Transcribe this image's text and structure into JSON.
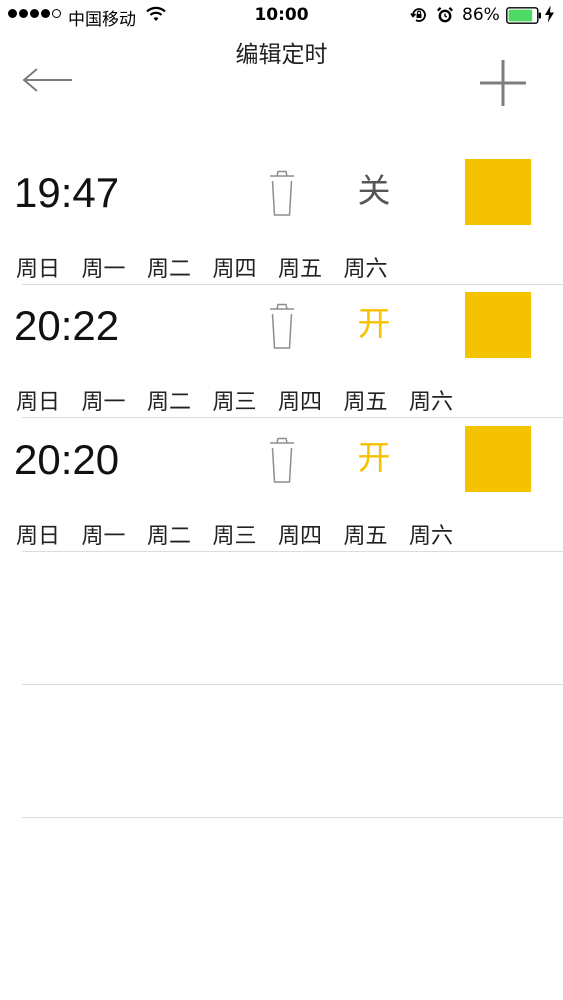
{
  "status_bar": {
    "signal_bars": [
      true,
      true,
      true,
      true,
      false
    ],
    "carrier": "中国移动",
    "wifi_icon": "wifi-icon",
    "time": "10:00",
    "rotation_lock_icon": "rotation-lock-icon",
    "alarm_icon": "alarm-icon",
    "battery_percent": "86%",
    "battery_level": 0.86,
    "battery_color": "#4cd964",
    "charging_icon": "bolt-icon"
  },
  "nav": {
    "title": "编辑定时",
    "back_icon": "back-arrow-icon",
    "add_icon": "plus-icon"
  },
  "colors": {
    "accent": "#f5c200",
    "off_text": "#555555",
    "separator": "#dcdcdc",
    "icon_gray": "#8e8e8e"
  },
  "timers": [
    {
      "time": "19:47",
      "delete_icon": "trash-icon",
      "state_label": "关",
      "state_on": false,
      "days": [
        "周日",
        "周一",
        "周二",
        "周四",
        "周五",
        "周六"
      ]
    },
    {
      "time": "20:22",
      "delete_icon": "trash-icon",
      "state_label": "开",
      "state_on": true,
      "days": [
        "周日",
        "周一",
        "周二",
        "周三",
        "周四",
        "周五",
        "周六"
      ]
    },
    {
      "time": "20:20",
      "delete_icon": "trash-icon",
      "state_label": "开",
      "state_on": true,
      "days": [
        "周日",
        "周一",
        "周二",
        "周三",
        "周四",
        "周五",
        "周六"
      ]
    }
  ]
}
